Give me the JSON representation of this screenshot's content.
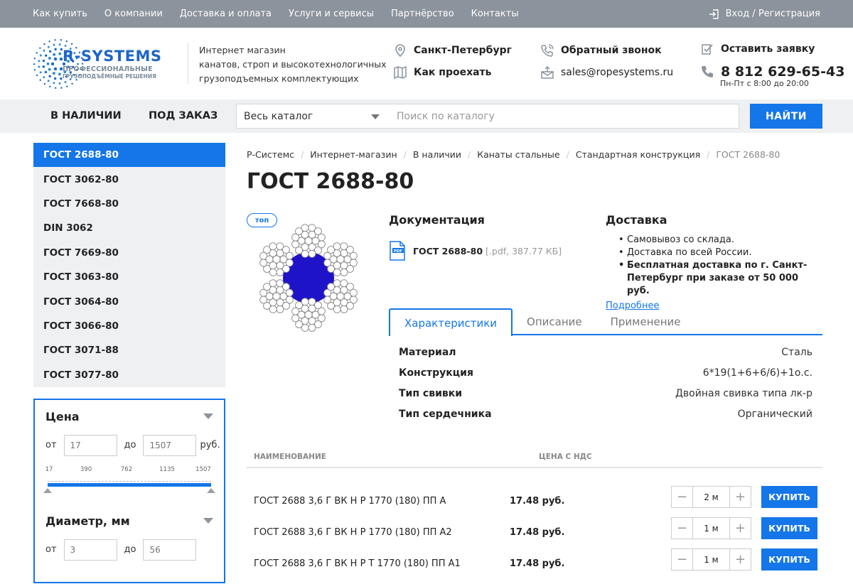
{
  "topbar": {
    "links": [
      "Как купить",
      "О компании",
      "Доставка и оплата",
      "Услуги и сервисы",
      "Партнёрство",
      "Контакты"
    ],
    "login": "Вход / Регистрация"
  },
  "header": {
    "logo_main": "R-SYSTEMS",
    "logo_sub1": "ПРОФЕССИОНАЛЬНЫЕ",
    "logo_sub2": "ГРУЗОПОДЪЁМНЫЕ РЕШЕНИЯ",
    "tagline": [
      "Интернет магазин",
      "канатов, строп и высокотехнологичных",
      "грузоподъемных комплектующих"
    ],
    "city": "Санкт-Петербург",
    "directions": "Как проехать",
    "callback": "Обратный звонок",
    "email": "sales@ropesystems.ru",
    "request": "Оставить заявку",
    "phone": "8 812 629-65-43",
    "hours": "Пн-Пт с 8:00 до 20:00"
  },
  "nav": {
    "tab_stock": "В НАЛИЧИИ",
    "tab_order": "ПОД ЗАКАЗ",
    "catalog_select": "Весь каталог",
    "search_placeholder": "Поиск по каталогу",
    "find_button": "НАЙТИ"
  },
  "sidebar": {
    "categories": [
      "ГОСТ 2688-80",
      "ГОСТ 3062-80",
      "ГОСТ 7668-80",
      "DIN 3062",
      "ГОСТ 7669-80",
      "ГОСТ 3063-80",
      "ГОСТ 3064-80",
      "ГОСТ 3066-80",
      "ГОСТ 3071-88",
      "ГОСТ 3077-80"
    ],
    "active_index": 0,
    "price": {
      "title": "Цена",
      "from_label": "от",
      "to_label": "до",
      "unit": "руб.",
      "from_placeholder": "17",
      "to_placeholder": "1507",
      "ticks": [
        "17",
        "390",
        "762",
        "1135",
        "1507"
      ]
    },
    "diameter": {
      "title": "Диаметр, мм",
      "from_label": "от",
      "to_label": "до",
      "from_placeholder": "3",
      "to_placeholder": "56"
    }
  },
  "breadcrumbs": [
    "Р-Системс",
    "Интернет-магазин",
    "В наличии",
    "Канаты стальные",
    "Стандартная конструкция",
    "ГОСТ 2688-80"
  ],
  "product": {
    "title": "ГОСТ 2688-80",
    "badge": "топ",
    "docs_title": "Документация",
    "doc_icon_text": "PDF",
    "doc_name": "ГОСТ 2688-80",
    "doc_meta": "[.pdf, 387.77 КБ]",
    "delivery_title": "Доставка",
    "delivery_items": [
      "Самовывоз со склада.",
      "Доставка по всей России.",
      "Бесплатная доставка по г. Санкт-Петербург при заказе от 50 000 руб."
    ],
    "delivery_more": "Подробнее",
    "tabs": [
      "Характеристики",
      "Описание",
      "Применение"
    ],
    "specs": [
      {
        "k": "Материал",
        "v": "Сталь"
      },
      {
        "k": "Конструкция",
        "v": "6*19(1+6+6/6)+1о.с."
      },
      {
        "k": "Тип свивки",
        "v": "Двойная свивка типа лк-р"
      },
      {
        "k": "Тип сердечника",
        "v": "Органический"
      }
    ]
  },
  "table": {
    "col_name": "НАИМЕНОВАНИЕ",
    "col_price": "ЦЕНА С НДС",
    "buy_label": "КУПИТЬ",
    "rows": [
      {
        "name": "ГОСТ 2688 3,6 Г ВК Н Р 1770 (180) ПП А",
        "price": "17.48 руб.",
        "qty": "2 м"
      },
      {
        "name": "ГОСТ 2688 3,6 Г ВК Н Р 1770 (180) ПП А2",
        "price": "17.48 руб.",
        "qty": "1 м"
      },
      {
        "name": "ГОСТ 2688 3,6 Г ВК Н Р Т 1770 (180) ПП А1",
        "price": "17.48 руб.",
        "qty": "1 м"
      }
    ]
  },
  "colors": {
    "accent": "#1476e8",
    "topbar": "#8b939c",
    "panel": "#eef0f2",
    "rope_core": "#1f13c9"
  }
}
